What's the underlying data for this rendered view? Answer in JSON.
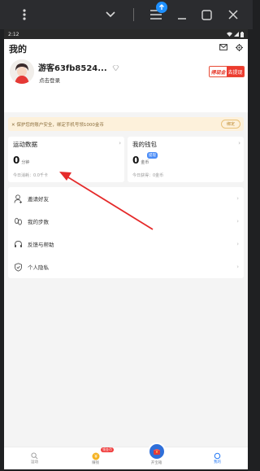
{
  "emulator": {
    "icons": [
      "more-vert-icon",
      "chevron-down-icon",
      "menu-icon",
      "upload-icon",
      "minimize-icon",
      "maximize-icon",
      "close-icon"
    ]
  },
  "statusbar": {
    "time": "2:12"
  },
  "header": {
    "title": "我的",
    "username": "游客63fb8524...",
    "login_hint": "点击登录",
    "promo_left": "得现金",
    "promo_right": "去提现"
  },
  "notice": {
    "text": "✕  保护您的账户安全，绑定手机号领1000金币",
    "button": "绑定"
  },
  "cards": [
    {
      "title": "运动数据",
      "value": "0",
      "unit": "分钟",
      "sub": "今日消耗：0.0千卡"
    },
    {
      "title": "我的钱包",
      "value": "0",
      "unit": "金币",
      "badge": "提现",
      "sub": "今日获得：0金币"
    }
  ],
  "menu": [
    {
      "label": "邀请好友",
      "icon": "user-add-icon"
    },
    {
      "label": "我的步数",
      "icon": "footprint-icon"
    },
    {
      "label": "反馈与帮助",
      "icon": "headset-icon"
    },
    {
      "label": "个人隐私",
      "icon": "shield-icon"
    }
  ],
  "nav": [
    {
      "label": "运动",
      "icon": "run-icon"
    },
    {
      "label": "赚钱",
      "icon": "coin-icon",
      "badge": "领金币"
    },
    {
      "label": "开宝箱",
      "icon": "chest-icon"
    },
    {
      "label": "我的",
      "icon": "profile-icon",
      "active": true
    }
  ],
  "colors": {
    "accent": "#2a7cf5",
    "promo": "#ed3a2e",
    "annotation": "#e52a2a"
  }
}
